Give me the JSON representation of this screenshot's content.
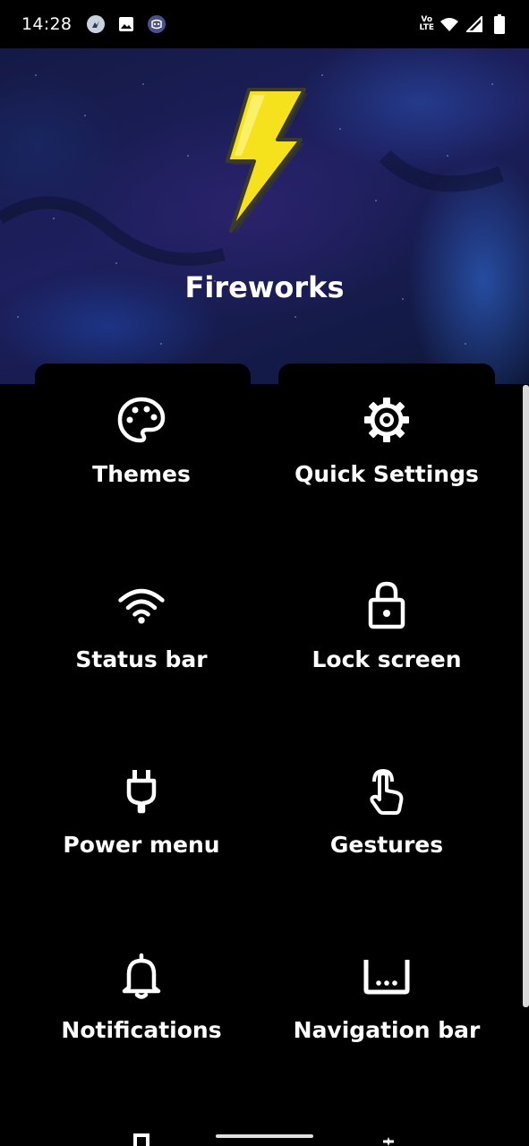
{
  "status_bar": {
    "time": "14:28",
    "left_icons": [
      "messenger-icon",
      "gallery-icon",
      "discord-icon"
    ],
    "volte_top": "Vo",
    "volte_bottom": "LTE",
    "right_icons": [
      "wifi-icon",
      "cell-signal-icon",
      "battery-icon"
    ]
  },
  "header": {
    "app_title": "Fireworks",
    "logo_icon": "lightning-bolt-icon",
    "bolt_color": "#f5e11c"
  },
  "categories": [
    {
      "label": "Themes",
      "icon": "palette-icon"
    },
    {
      "label": "Quick Settings",
      "icon": "gear-icon"
    },
    {
      "label": "Status bar",
      "icon": "wifi-icon"
    },
    {
      "label": "Lock screen",
      "icon": "lock-icon"
    },
    {
      "label": "Power menu",
      "icon": "plug-icon"
    },
    {
      "label": "Gestures",
      "icon": "touch-gesture-icon"
    },
    {
      "label": "Notifications",
      "icon": "bell-icon"
    },
    {
      "label": "Navigation bar",
      "icon": "navigation-bar-icon"
    }
  ]
}
